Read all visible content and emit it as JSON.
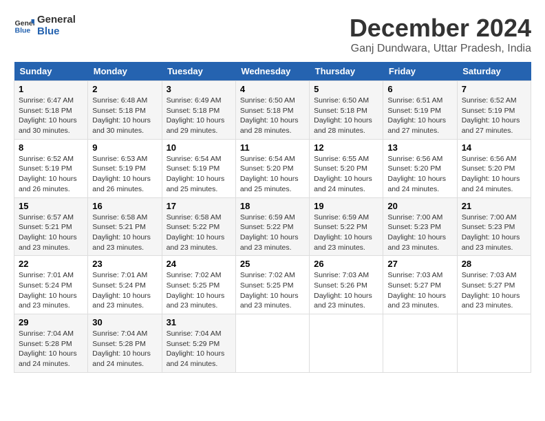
{
  "logo": {
    "line1": "General",
    "line2": "Blue"
  },
  "title": "December 2024",
  "subtitle": "Ganj Dundwara, Uttar Pradesh, India",
  "weekdays": [
    "Sunday",
    "Monday",
    "Tuesday",
    "Wednesday",
    "Thursday",
    "Friday",
    "Saturday"
  ],
  "weeks": [
    [
      {
        "day": 1,
        "sunrise": "6:47 AM",
        "sunset": "5:18 PM",
        "daylight": "10 hours and 30 minutes."
      },
      {
        "day": 2,
        "sunrise": "6:48 AM",
        "sunset": "5:18 PM",
        "daylight": "10 hours and 30 minutes."
      },
      {
        "day": 3,
        "sunrise": "6:49 AM",
        "sunset": "5:18 PM",
        "daylight": "10 hours and 29 minutes."
      },
      {
        "day": 4,
        "sunrise": "6:50 AM",
        "sunset": "5:18 PM",
        "daylight": "10 hours and 28 minutes."
      },
      {
        "day": 5,
        "sunrise": "6:50 AM",
        "sunset": "5:18 PM",
        "daylight": "10 hours and 28 minutes."
      },
      {
        "day": 6,
        "sunrise": "6:51 AM",
        "sunset": "5:19 PM",
        "daylight": "10 hours and 27 minutes."
      },
      {
        "day": 7,
        "sunrise": "6:52 AM",
        "sunset": "5:19 PM",
        "daylight": "10 hours and 27 minutes."
      }
    ],
    [
      {
        "day": 8,
        "sunrise": "6:52 AM",
        "sunset": "5:19 PM",
        "daylight": "10 hours and 26 minutes."
      },
      {
        "day": 9,
        "sunrise": "6:53 AM",
        "sunset": "5:19 PM",
        "daylight": "10 hours and 26 minutes."
      },
      {
        "day": 10,
        "sunrise": "6:54 AM",
        "sunset": "5:19 PM",
        "daylight": "10 hours and 25 minutes."
      },
      {
        "day": 11,
        "sunrise": "6:54 AM",
        "sunset": "5:20 PM",
        "daylight": "10 hours and 25 minutes."
      },
      {
        "day": 12,
        "sunrise": "6:55 AM",
        "sunset": "5:20 PM",
        "daylight": "10 hours and 24 minutes."
      },
      {
        "day": 13,
        "sunrise": "6:56 AM",
        "sunset": "5:20 PM",
        "daylight": "10 hours and 24 minutes."
      },
      {
        "day": 14,
        "sunrise": "6:56 AM",
        "sunset": "5:20 PM",
        "daylight": "10 hours and 24 minutes."
      }
    ],
    [
      {
        "day": 15,
        "sunrise": "6:57 AM",
        "sunset": "5:21 PM",
        "daylight": "10 hours and 23 minutes."
      },
      {
        "day": 16,
        "sunrise": "6:58 AM",
        "sunset": "5:21 PM",
        "daylight": "10 hours and 23 minutes."
      },
      {
        "day": 17,
        "sunrise": "6:58 AM",
        "sunset": "5:22 PM",
        "daylight": "10 hours and 23 minutes."
      },
      {
        "day": 18,
        "sunrise": "6:59 AM",
        "sunset": "5:22 PM",
        "daylight": "10 hours and 23 minutes."
      },
      {
        "day": 19,
        "sunrise": "6:59 AM",
        "sunset": "5:22 PM",
        "daylight": "10 hours and 23 minutes."
      },
      {
        "day": 20,
        "sunrise": "7:00 AM",
        "sunset": "5:23 PM",
        "daylight": "10 hours and 23 minutes."
      },
      {
        "day": 21,
        "sunrise": "7:00 AM",
        "sunset": "5:23 PM",
        "daylight": "10 hours and 23 minutes."
      }
    ],
    [
      {
        "day": 22,
        "sunrise": "7:01 AM",
        "sunset": "5:24 PM",
        "daylight": "10 hours and 23 minutes."
      },
      {
        "day": 23,
        "sunrise": "7:01 AM",
        "sunset": "5:24 PM",
        "daylight": "10 hours and 23 minutes."
      },
      {
        "day": 24,
        "sunrise": "7:02 AM",
        "sunset": "5:25 PM",
        "daylight": "10 hours and 23 minutes."
      },
      {
        "day": 25,
        "sunrise": "7:02 AM",
        "sunset": "5:25 PM",
        "daylight": "10 hours and 23 minutes."
      },
      {
        "day": 26,
        "sunrise": "7:03 AM",
        "sunset": "5:26 PM",
        "daylight": "10 hours and 23 minutes."
      },
      {
        "day": 27,
        "sunrise": "7:03 AM",
        "sunset": "5:27 PM",
        "daylight": "10 hours and 23 minutes."
      },
      {
        "day": 28,
        "sunrise": "7:03 AM",
        "sunset": "5:27 PM",
        "daylight": "10 hours and 23 minutes."
      }
    ],
    [
      {
        "day": 29,
        "sunrise": "7:04 AM",
        "sunset": "5:28 PM",
        "daylight": "10 hours and 24 minutes."
      },
      {
        "day": 30,
        "sunrise": "7:04 AM",
        "sunset": "5:28 PM",
        "daylight": "10 hours and 24 minutes."
      },
      {
        "day": 31,
        "sunrise": "7:04 AM",
        "sunset": "5:29 PM",
        "daylight": "10 hours and 24 minutes."
      },
      null,
      null,
      null,
      null
    ]
  ]
}
